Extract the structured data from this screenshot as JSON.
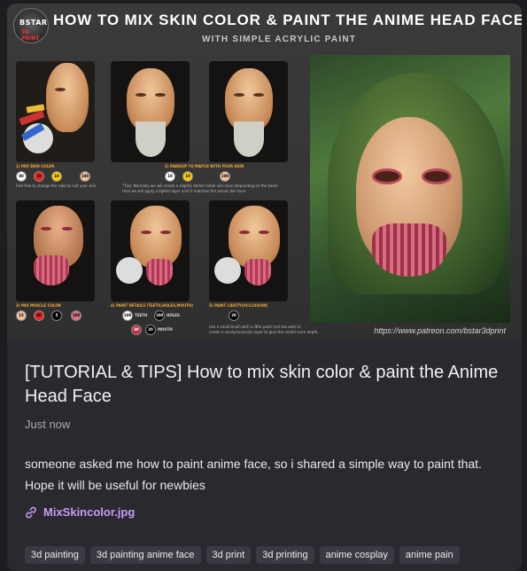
{
  "hero": {
    "logo_top": "BSTAR",
    "logo_bottom": "3D PRINT",
    "title": "HOW TO MIX SKIN COLOR & PAINT THE ANIME HEAD FACE",
    "subtitle": "WITH SIMPLE ACRYLIC PAINT",
    "captions": {
      "step1": "1) MIX SKIN COLOR",
      "step2": "2) MAKEUP TO MATCH WITH YOUR SKIN",
      "step3": "3) MIX MUSCLE COLOR",
      "step4": "4) PAINT DETAILS (TEETH,HOLES,MOUTH)",
      "step5": "5) PAINT CAVITY(OCCLUSION)"
    },
    "notes": {
      "step1": "Feel free to change the ratio to suit your skin",
      "step2_a": "*Tips: Normally we will create a slightly darker initial skin tone (depending on the base)",
      "step2_b": "then we will apply a lighter layer until it matches the actual skin tone.",
      "step5_a": "Use a small brush with a little paint (not too wet) to",
      "step5_b": "create a cavity/occlusion layer to give the model more depth."
    },
    "mix1": [
      "80",
      "10",
      "10",
      "100"
    ],
    "mix2": [
      "10",
      "10",
      "100"
    ],
    "mix3": [
      "15",
      "80",
      "5",
      "100"
    ],
    "mix4": [
      "100",
      "TEETH",
      "100",
      "HOLES",
      "80",
      "20",
      "MOUTH"
    ],
    "mix5": [
      "20"
    ],
    "url": "https://www.patreon.com/bstar3dprint"
  },
  "post": {
    "title": "[TUTORIAL & TIPS] How to mix skin color & paint the Anime Head Face",
    "time": "Just now",
    "description": "someone asked me how to paint anime face, so i shared a simple way to paint that. Hope it will be useful for newbies",
    "attachment": "MixSkincolor.jpg"
  },
  "tags": [
    "3d painting",
    "3d painting anime face",
    "3d print",
    "3d printing",
    "anime cosplay",
    "anime pain"
  ],
  "colors": {
    "accent": "#c69cf5",
    "card": "#2a2930",
    "tag_bg": "#3b3a42"
  }
}
